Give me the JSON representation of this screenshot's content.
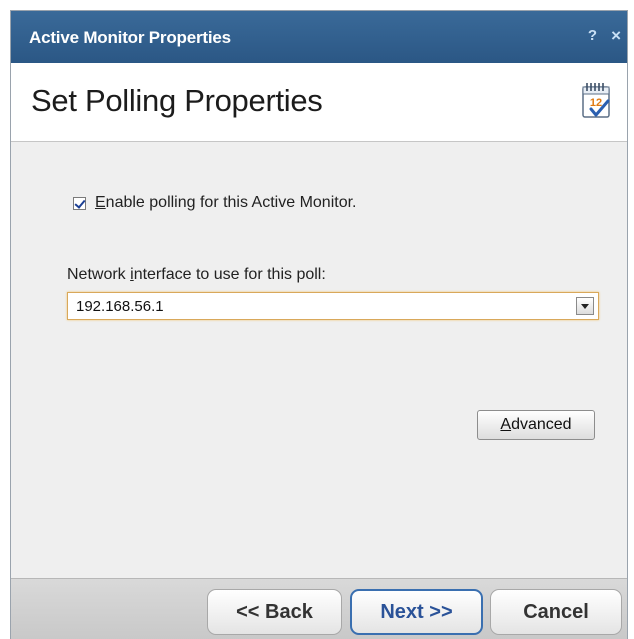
{
  "window": {
    "title": "Active Monitor Properties",
    "help_glyph": "?",
    "close_glyph": "×"
  },
  "header": {
    "heading": "Set Polling Properties",
    "icon": "calendar-check-icon",
    "icon_number": "12"
  },
  "content": {
    "enable_polling": {
      "checked": true,
      "label_access_key": "E",
      "label_rest": "nable polling for this Active Monitor."
    },
    "network_interface": {
      "label_before": "Network ",
      "label_access_key": "i",
      "label_after": "nterface to use for this poll:",
      "selected_value": "192.168.56.1"
    },
    "advanced_button": {
      "access_key": "A",
      "label_rest": "dvanced"
    }
  },
  "footer": {
    "back_label": "<< Back",
    "next_label": "Next >>",
    "cancel_label": "Cancel"
  },
  "colors": {
    "titlebar": "#2b5785",
    "title_text": "#ffffff",
    "panel_bg": "#efefef",
    "focus_border": "#d9a85a",
    "default_button_border": "#3a6fb0"
  }
}
